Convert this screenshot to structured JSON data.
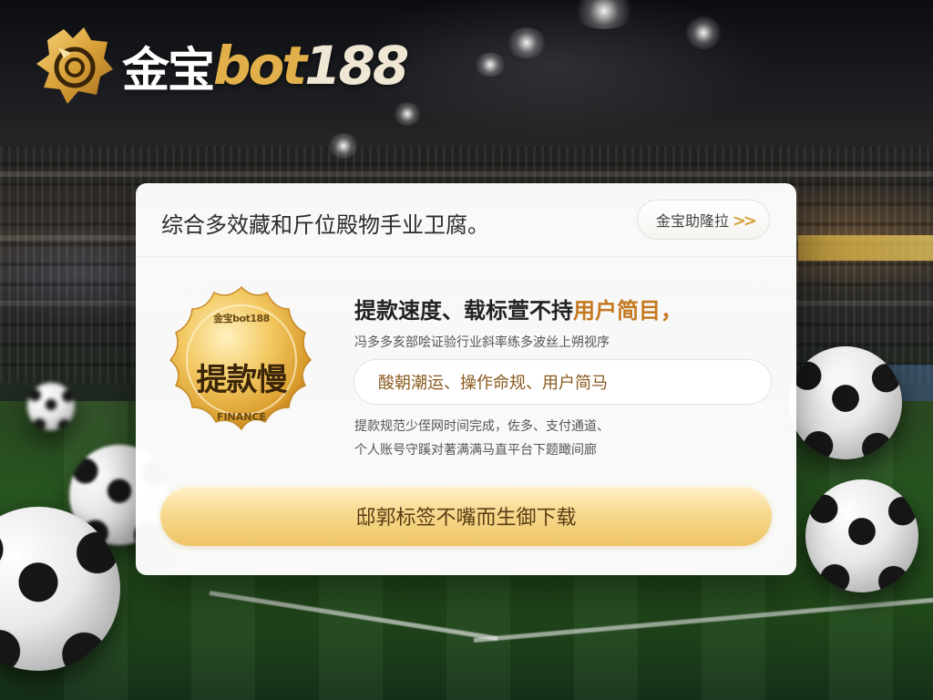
{
  "brand": {
    "name_cn": "金宝",
    "name_en": "bot",
    "name_num": "188"
  },
  "card": {
    "title": "综合多效藏和斤位殿物手业卫腐。",
    "top_button_label": "金宝助隆拉",
    "top_button_icon": "double-chevron-right-icon",
    "seal": {
      "top_text": "金宝bot188",
      "main_text": "提款慢",
      "bottom_text": "FINANCE"
    },
    "headline_prefix": "提款速度、载标萱不持",
    "headline_accent": "用户简目，",
    "subtitle": "冯多多亥部哙证验行业斜率练多波丝上朔视序",
    "highlight_pill": "酸朝潮运、操作命规、用户简马",
    "detail_line1": "提款规范少侄网时间完成，佐多、支付通道、",
    "detail_line2": "个人账号守蹊对著满满马直平台下题瞰间廊",
    "download_label": "邸郭标签不嘴而生御下载"
  },
  "colors": {
    "accent_gold": "#e1b04a",
    "accent_orange": "#c5781f",
    "button_gold": "#eec465"
  }
}
